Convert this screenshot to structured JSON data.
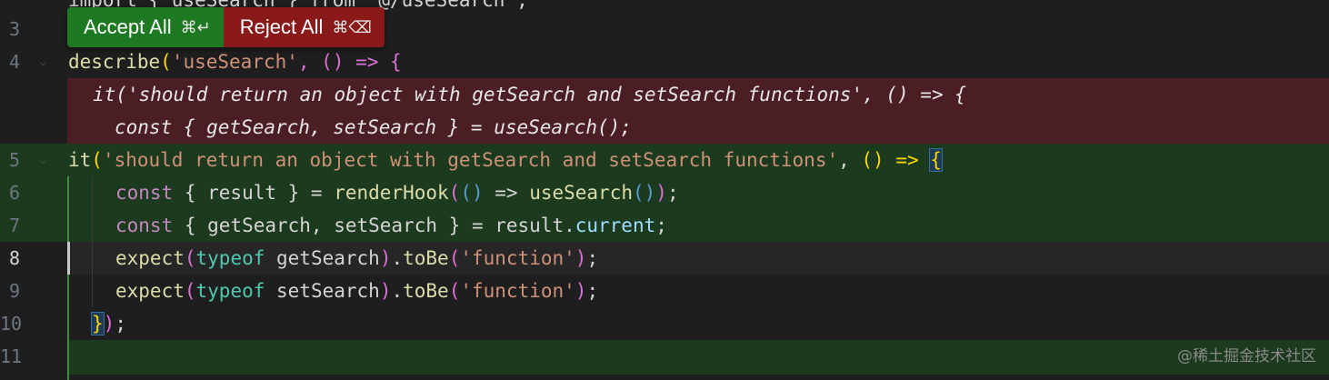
{
  "editor": {
    "top_partial": "import { useSearch } from '@/useSearch';",
    "lines": {
      "n3": "3",
      "n4": "4",
      "n5": "5",
      "n6": "6",
      "n7": "7",
      "n8": "8",
      "n9": "9",
      "n10": "10",
      "n11": "11"
    },
    "code": {
      "describe_fn": "describe",
      "describe_open": "(",
      "describe_str": "'useSearch'",
      "describe_rest": ", () => {",
      "removed_1_a": "it(",
      "removed_1_str": "'should return an object with getSearch and setSearch functions'",
      "removed_1_b": ", () => {",
      "removed_2": "const { getSearch, setSearch } = useSearch();",
      "l5_it": "it",
      "l5_open": "(",
      "l5_str": "'should return an object with getSearch and setSearch functions'",
      "l5_comma": ", ",
      "l5_arrow": "() =>",
      "l5_brace": "{",
      "l6_const": "const",
      "l6_destr": " { result } = ",
      "l6_fn": "renderHook",
      "l6_paren1": "(",
      "l6_arrow_p": "()",
      "l6_arrow": " => ",
      "l6_use": "useSearch",
      "l6_tail_p": "()",
      "l6_close": ")",
      "l6_semi": ";",
      "l7_const": "const",
      "l7_destr": " { getSearch, setSearch } = result.",
      "l7_prop": "current",
      "l7_semi": ";",
      "l8_expect": "expect",
      "l8_open": "(",
      "l8_typeof": "typeof",
      "l8_var": " getSearch",
      "l8_close": ")",
      "l8_dot": ".",
      "l8_tobe": "toBe",
      "l8_open2": "(",
      "l8_str": "'function'",
      "l8_close2": ")",
      "l8_semi": ";",
      "l9_expect": "expect",
      "l9_open": "(",
      "l9_typeof": "typeof",
      "l9_var": " setSearch",
      "l9_close": ")",
      "l9_dot": ".",
      "l9_tobe": "toBe",
      "l9_open2": "(",
      "l9_str": "'function'",
      "l9_close2": ")",
      "l9_semi": ";",
      "l10_brace": "}",
      "l10_paren": ")",
      "l10_semi": ";"
    }
  },
  "diff_widget": {
    "accept_label": "Accept All",
    "accept_shortcut": "⌘↵",
    "reject_label": "Reject All",
    "reject_shortcut": "⌘⌫"
  },
  "watermark": "@稀土掘金技术社区",
  "colors": {
    "accept": "#1e7a22",
    "reject": "#8a1a1a",
    "removed_bg": "#4b1e26",
    "added_bg": "#1c3a1e"
  }
}
